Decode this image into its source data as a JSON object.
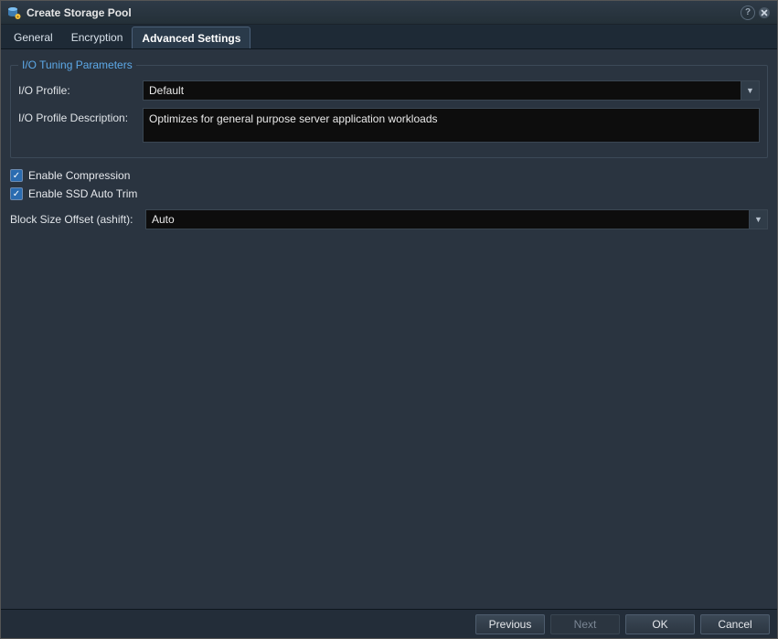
{
  "window": {
    "title": "Create Storage Pool"
  },
  "tabs": {
    "general": "General",
    "encryption": "Encryption",
    "advanced": "Advanced Settings"
  },
  "group": {
    "legend": "I/O Tuning Parameters",
    "profile_label": "I/O Profile:",
    "profile_value": "Default",
    "desc_label": "I/O Profile Description:",
    "desc_value": "Optimizes for general purpose server application workloads"
  },
  "opts": {
    "compression_label": "Enable Compression",
    "autotrim_label": "Enable SSD Auto Trim",
    "ashift_label": "Block Size Offset (ashift):",
    "ashift_value": "Auto"
  },
  "buttons": {
    "previous": "Previous",
    "next": "Next",
    "ok": "OK",
    "cancel": "Cancel"
  }
}
